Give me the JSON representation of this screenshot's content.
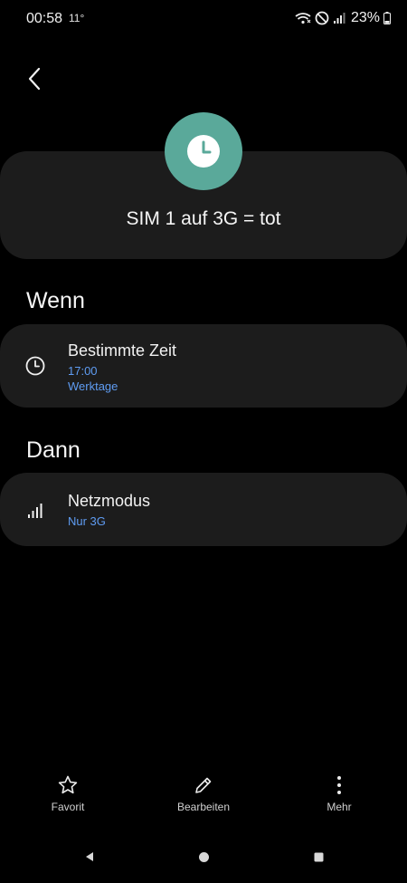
{
  "status_bar": {
    "time": "00:58",
    "temperature": "11°",
    "battery": "23%",
    "icons": [
      "wifi-icon",
      "do-not-disturb-icon",
      "signal-icon",
      "battery-icon"
    ]
  },
  "header": {
    "back_icon": "chevron-left-icon",
    "routine_icon": "clock-icon",
    "routine_icon_color": "#5aa99a",
    "routine_title": "SIM 1 auf 3G = tot"
  },
  "when_section": {
    "title": "Wenn",
    "condition": {
      "icon": "clock-icon",
      "name": "Bestimmte Zeit",
      "time": "17:00",
      "days": "Werktage"
    }
  },
  "then_section": {
    "title": "Dann",
    "action": {
      "icon": "signal-bars-icon",
      "name": "Netzmodus",
      "value": "Nur 3G"
    }
  },
  "bottom_actions": {
    "favorite": "Favorit",
    "edit": "Bearbeiten",
    "more": "Mehr"
  },
  "accent_color": "#5f9cf2"
}
